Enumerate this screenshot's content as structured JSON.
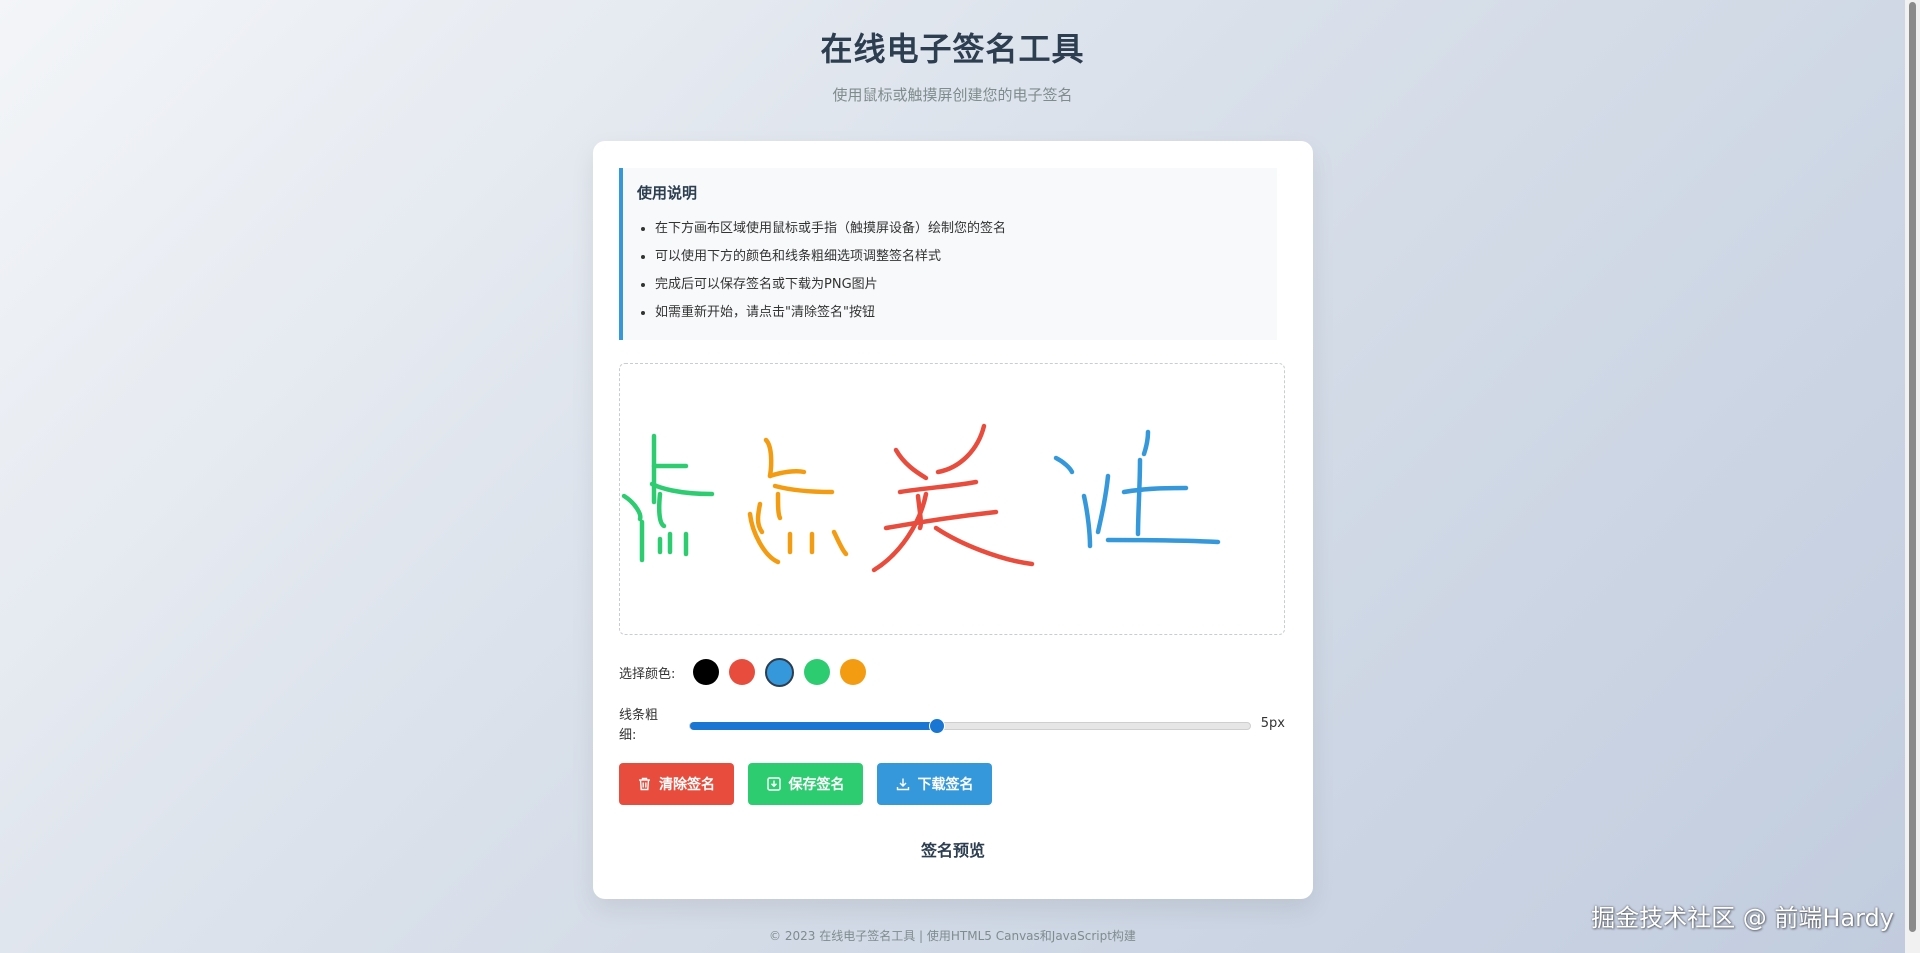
{
  "header": {
    "title": "在线电子签名工具",
    "subtitle": "使用鼠标或触摸屏创建您的电子签名"
  },
  "instructions": {
    "title": "使用说明",
    "items": [
      "在下方画布区域使用鼠标或手指（触摸屏设备）绘制您的签名",
      "可以使用下方的颜色和线条粗细选项调整签名样式",
      "完成后可以保存签名或下载为PNG图片",
      "如需重新开始，请点击\"清除签名\"按钮"
    ]
  },
  "colors": {
    "label": "选择颜色:",
    "swatches": [
      "#000000",
      "#e74c3c",
      "#3498db",
      "#2ecc71",
      "#f39c12"
    ],
    "selected": "#3498db"
  },
  "line_width": {
    "label": "线条粗细:",
    "value_text": "5px",
    "value_fraction": 0.44
  },
  "buttons": {
    "clear": "清除签名",
    "save": "保存签名",
    "download": "下载签名"
  },
  "preview": {
    "title": "签名预览"
  },
  "footer": {
    "text": "© 2023 在线电子签名工具 | 使用HTML5 Canvas和JavaScript构建"
  },
  "watermark": {
    "text": "掘金技术社区 @ 前端Hardy"
  }
}
